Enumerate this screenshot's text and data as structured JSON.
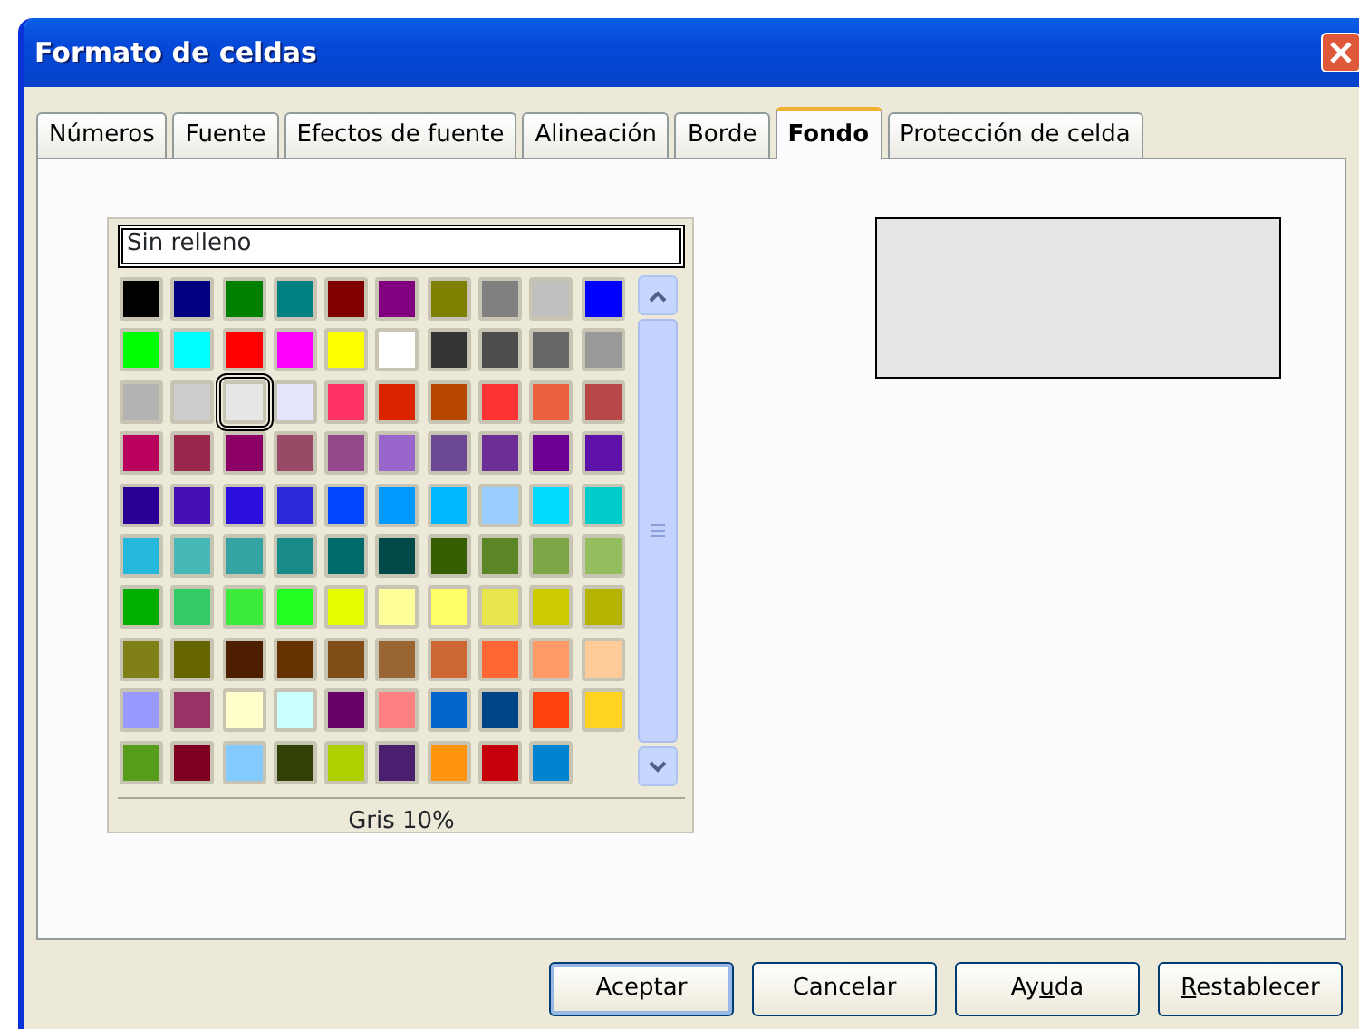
{
  "window": {
    "title": "Formato de celdas"
  },
  "tabs": [
    {
      "label": "Números",
      "selected": false
    },
    {
      "label": "Fuente",
      "selected": false
    },
    {
      "label": "Efectos de fuente",
      "selected": false
    },
    {
      "label": "Alineación",
      "selected": false
    },
    {
      "label": "Borde",
      "selected": false
    },
    {
      "label": "Fondo",
      "selected": true
    },
    {
      "label": "Protección de celda",
      "selected": false
    }
  ],
  "palette": {
    "none_option": "Sin relleno",
    "selected_name": "Gris 10%",
    "swatches": [
      {
        "color": "#000000",
        "selected": false
      },
      {
        "color": "#000080",
        "selected": false
      },
      {
        "color": "#008000",
        "selected": false
      },
      {
        "color": "#008080",
        "selected": false
      },
      {
        "color": "#800000",
        "selected": false
      },
      {
        "color": "#800080",
        "selected": false
      },
      {
        "color": "#808000",
        "selected": false
      },
      {
        "color": "#808080",
        "selected": false
      },
      {
        "color": "#c0c0c0",
        "selected": false
      },
      {
        "color": "#0000ff",
        "selected": false
      },
      {
        "color": "#00ff00",
        "selected": false
      },
      {
        "color": "#00ffff",
        "selected": false
      },
      {
        "color": "#ff0000",
        "selected": false
      },
      {
        "color": "#ff00ff",
        "selected": false
      },
      {
        "color": "#ffff00",
        "selected": false
      },
      {
        "color": "#ffffff",
        "selected": false
      },
      {
        "color": "#333333",
        "selected": false
      },
      {
        "color": "#4d4d4d",
        "selected": false
      },
      {
        "color": "#666666",
        "selected": false
      },
      {
        "color": "#999999",
        "selected": false
      },
      {
        "color": "#b3b3b3",
        "selected": false
      },
      {
        "color": "#cccccc",
        "selected": false
      },
      {
        "color": "#e6e6e6",
        "selected": true
      },
      {
        "color": "#e6e6ff",
        "selected": false
      },
      {
        "color": "#ff3366",
        "selected": false
      },
      {
        "color": "#dc2300",
        "selected": false
      },
      {
        "color": "#b84700",
        "selected": false
      },
      {
        "color": "#ff3333",
        "selected": false
      },
      {
        "color": "#eb613d",
        "selected": false
      },
      {
        "color": "#b84747",
        "selected": false
      },
      {
        "color": "#b8005c",
        "selected": false
      },
      {
        "color": "#99284c",
        "selected": false
      },
      {
        "color": "#8c0066",
        "selected": false
      },
      {
        "color": "#994a66",
        "selected": false
      },
      {
        "color": "#94498c",
        "selected": false
      },
      {
        "color": "#9966cc",
        "selected": false
      },
      {
        "color": "#6b4794",
        "selected": false
      },
      {
        "color": "#6b2e94",
        "selected": false
      },
      {
        "color": "#6d0094",
        "selected": false
      },
      {
        "color": "#5e11a6",
        "selected": false
      },
      {
        "color": "#2a0094",
        "selected": false
      },
      {
        "color": "#450fb8",
        "selected": false
      },
      {
        "color": "#2a0fdd",
        "selected": false
      },
      {
        "color": "#2a2ada",
        "selected": false
      },
      {
        "color": "#0047ff",
        "selected": false
      },
      {
        "color": "#0099ff",
        "selected": false
      },
      {
        "color": "#00b8ff",
        "selected": false
      },
      {
        "color": "#99ccff",
        "selected": false
      },
      {
        "color": "#00dcff",
        "selected": false
      },
      {
        "color": "#00cccc",
        "selected": false
      },
      {
        "color": "#23b8dc",
        "selected": false
      },
      {
        "color": "#47b8b8",
        "selected": false
      },
      {
        "color": "#33a3a3",
        "selected": false
      },
      {
        "color": "#198a8a",
        "selected": false
      },
      {
        "color": "#006b6b",
        "selected": false
      },
      {
        "color": "#004a4a",
        "selected": false
      },
      {
        "color": "#355e00",
        "selected": false
      },
      {
        "color": "#5c8526",
        "selected": false
      },
      {
        "color": "#7da647",
        "selected": false
      },
      {
        "color": "#94bd5e",
        "selected": false
      },
      {
        "color": "#00ae00",
        "selected": false
      },
      {
        "color": "#33cc66",
        "selected": false
      },
      {
        "color": "#3deb3d",
        "selected": false
      },
      {
        "color": "#23ff23",
        "selected": false
      },
      {
        "color": "#e6ff00",
        "selected": false
      },
      {
        "color": "#ffff99",
        "selected": false
      },
      {
        "color": "#ffff66",
        "selected": false
      },
      {
        "color": "#e6e64c",
        "selected": false
      },
      {
        "color": "#cccc00",
        "selected": false
      },
      {
        "color": "#b3b300",
        "selected": false
      },
      {
        "color": "#808019",
        "selected": false
      },
      {
        "color": "#666600",
        "selected": false
      },
      {
        "color": "#4d1f00",
        "selected": false
      },
      {
        "color": "#663300",
        "selected": false
      },
      {
        "color": "#804d19",
        "selected": false
      },
      {
        "color": "#996633",
        "selected": false
      },
      {
        "color": "#cc6633",
        "selected": false
      },
      {
        "color": "#ff6633",
        "selected": false
      },
      {
        "color": "#ff9966",
        "selected": false
      },
      {
        "color": "#ffcc99",
        "selected": false
      },
      {
        "color": "#9999ff",
        "selected": false
      },
      {
        "color": "#993366",
        "selected": false
      },
      {
        "color": "#ffffcc",
        "selected": false
      },
      {
        "color": "#ccffff",
        "selected": false
      },
      {
        "color": "#660066",
        "selected": false
      },
      {
        "color": "#ff8080",
        "selected": false
      },
      {
        "color": "#0066cc",
        "selected": false
      },
      {
        "color": "#004586",
        "selected": false
      },
      {
        "color": "#ff420e",
        "selected": false
      },
      {
        "color": "#ffd320",
        "selected": false
      },
      {
        "color": "#579d1c",
        "selected": false
      },
      {
        "color": "#7e0021",
        "selected": false
      },
      {
        "color": "#83caff",
        "selected": false
      },
      {
        "color": "#314004",
        "selected": false
      },
      {
        "color": "#aecf00",
        "selected": false
      },
      {
        "color": "#4b1f6f",
        "selected": false
      },
      {
        "color": "#ff950e",
        "selected": false
      },
      {
        "color": "#c5000b",
        "selected": false
      },
      {
        "color": "#0084d1",
        "selected": false
      }
    ]
  },
  "preview": {
    "color": "#e6e6e6"
  },
  "buttons": [
    {
      "label": "Aceptar",
      "default": true
    },
    {
      "label": "Cancelar",
      "default": false
    },
    {
      "label": "Ay",
      "access_key": "u",
      "label_rest": "da",
      "default": false
    },
    {
      "access_key": "R",
      "label_rest": "establecer",
      "default": false
    }
  ]
}
